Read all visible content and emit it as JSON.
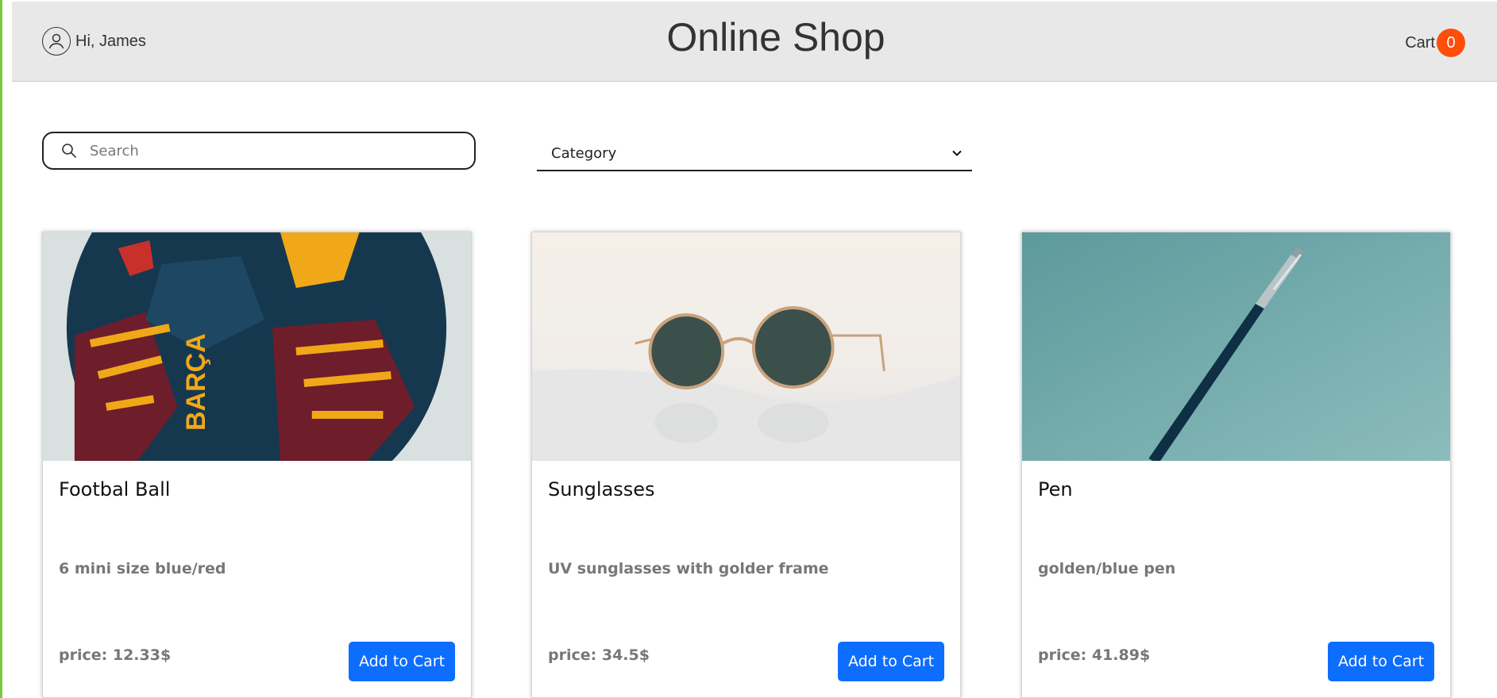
{
  "header": {
    "greeting": "Hi, James",
    "title": "Online Shop",
    "cart_label": "Cart",
    "cart_count": "0"
  },
  "filters": {
    "search_placeholder": "Search",
    "category_selected": "Category"
  },
  "products": [
    {
      "name": "Footbal Ball",
      "description": "6 mini size blue/red",
      "price": "price: 12.33$",
      "button": "Add to Cart"
    },
    {
      "name": "Sunglasses",
      "description": "UV sunglasses with golder frame",
      "price": "price: 34.5$",
      "button": "Add to Cart"
    },
    {
      "name": "Pen",
      "description": "golden/blue pen",
      "price": "price: 41.89$",
      "button": "Add to Cart"
    }
  ],
  "colors": {
    "header_bg": "#e8e8e8",
    "badge": "#ff4d0a",
    "button": "#0d6efd",
    "edge": "#7ac943"
  },
  "icons": [
    "user-icon",
    "search-icon",
    "chevron-down-icon"
  ]
}
